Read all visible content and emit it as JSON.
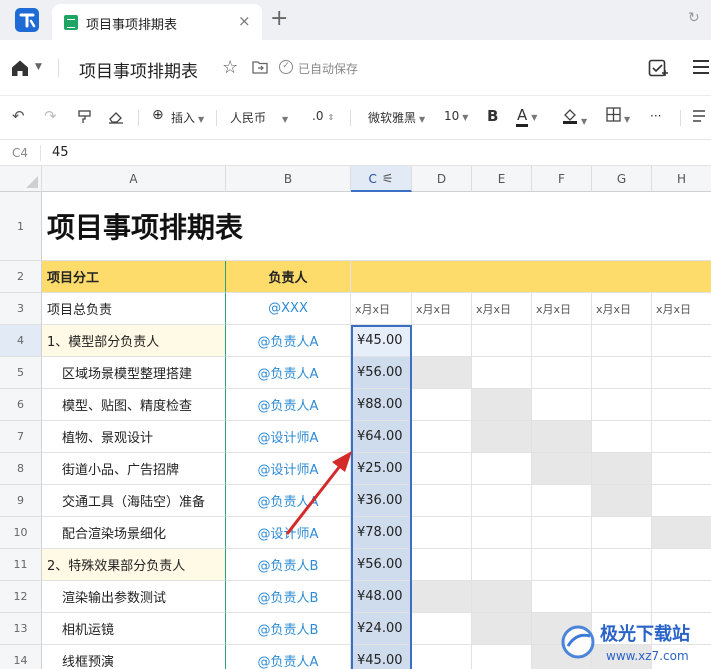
{
  "tabbar": {
    "tab_title": "项目事项排期表",
    "close": "×",
    "new_tab": "+",
    "refresh": "↻"
  },
  "header": {
    "title": "项目事项排期表",
    "save_status": "已自动保存",
    "save_icon": "✓"
  },
  "toolbar": {
    "insert": "插入",
    "currency": "人民币",
    "decimal": ".0",
    "font": "微软雅黑",
    "font_size": "10",
    "bold": "B",
    "text_color_letter": "A",
    "more": "···"
  },
  "formula_bar": {
    "cell_ref": "C4",
    "value": "45"
  },
  "columns": [
    "A",
    "B",
    "C",
    "D",
    "E",
    "F",
    "G",
    "H"
  ],
  "rows": [
    "1",
    "2",
    "3",
    "4",
    "5",
    "6",
    "7",
    "8",
    "9",
    "10",
    "11",
    "12",
    "13",
    "14"
  ],
  "sheet": {
    "title": "项目事项排期表",
    "header_a": "项目分工",
    "header_b": "负责人",
    "row3": {
      "a": "项目总负责",
      "b": "@XXX",
      "dates": [
        "x月x日",
        "x月x日",
        "x月x日",
        "x月x日",
        "x月x日",
        "x月x日"
      ]
    },
    "items": [
      {
        "a": "1、模型部分负责人",
        "b": "@负责人A",
        "c": "¥45.00"
      },
      {
        "a": "区域场景模型整理搭建",
        "b": "@负责人A",
        "c": "¥56.00"
      },
      {
        "a": "模型、贴图、精度检查",
        "b": "@负责人A",
        "c": "¥88.00"
      },
      {
        "a": "植物、景观设计",
        "b": "@设计师A",
        "c": "¥64.00"
      },
      {
        "a": "街道小品、广告招牌",
        "b": "@设计师A",
        "c": "¥25.00"
      },
      {
        "a": "交通工具（海陆空）准备",
        "b": "@负责人A",
        "c": "¥36.00"
      },
      {
        "a": "配合渲染场景细化",
        "b": "@设计师A",
        "c": "¥78.00"
      },
      {
        "a": "2、特殊效果部分负责人",
        "b": "@负责人B",
        "c": "¥56.00"
      },
      {
        "a": "渲染输出参数测试",
        "b": "@负责人B",
        "c": "¥48.00"
      },
      {
        "a": "相机运镜",
        "b": "@负责人B",
        "c": "¥24.00"
      },
      {
        "a": "线框预演",
        "b": "@负责人A",
        "c": "¥45.00"
      }
    ]
  },
  "watermark": {
    "text": "极光下载站",
    "url": "www.xz7.com"
  },
  "colors": {
    "accent": "#3a6fc4",
    "link": "#2e8bd6",
    "header_yellow": "#fddc6b",
    "section_cream": "#fffae6",
    "arrow": "#d42a2a"
  }
}
